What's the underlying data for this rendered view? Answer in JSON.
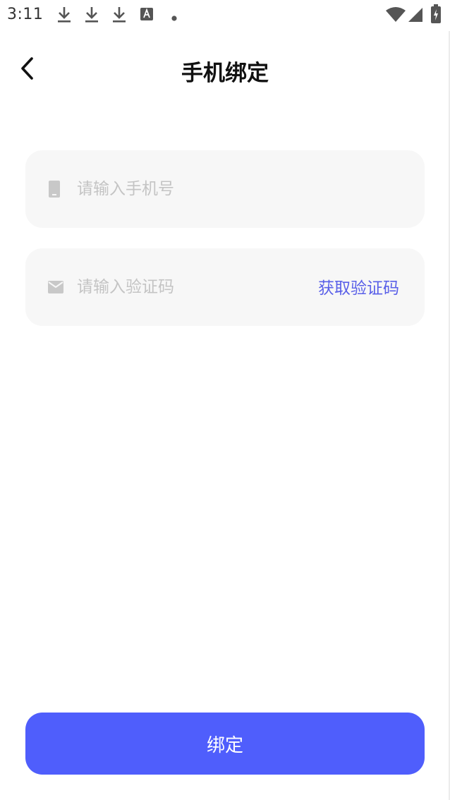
{
  "status_bar": {
    "time": "3:11",
    "icons": [
      "download-icon",
      "download-icon",
      "download-icon",
      "text-a-icon",
      "dot-icon",
      "wifi-icon",
      "signal-icon",
      "battery-charging-icon"
    ]
  },
  "header": {
    "title": "手机绑定",
    "back_icon": "chevron-left-icon"
  },
  "form": {
    "phone": {
      "icon": "phone-icon",
      "placeholder": "请输入手机号",
      "value": ""
    },
    "code": {
      "icon": "mail-icon",
      "placeholder": "请输入验证码",
      "value": "",
      "action_label": "获取验证码"
    }
  },
  "submit": {
    "label": "绑定"
  },
  "colors": {
    "accent": "#4f5efc",
    "link": "#5a60e8",
    "field_bg": "#f7f7f7",
    "placeholder": "#c4c4c4"
  }
}
